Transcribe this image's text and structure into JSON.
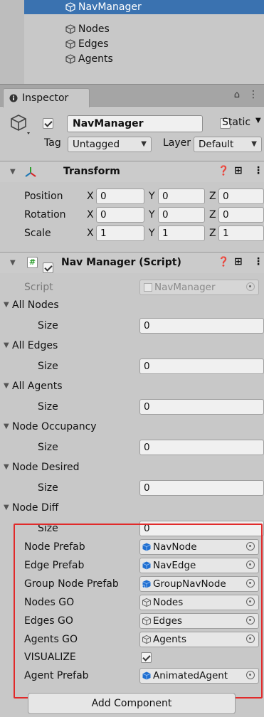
{
  "hierarchy": {
    "items": [
      {
        "label": "NavManager",
        "selected": true
      },
      {
        "label": "Nodes"
      },
      {
        "label": "Edges"
      },
      {
        "label": "Agents"
      }
    ]
  },
  "inspector": {
    "tab_label": "Inspector",
    "object_name": "NavManager",
    "static_label": "Static",
    "tag_label": "Tag",
    "tag_value": "Untagged",
    "layer_label": "Layer",
    "layer_value": "Default"
  },
  "transform": {
    "title": "Transform",
    "rows": [
      {
        "label": "Position",
        "x": "0",
        "y": "0",
        "z": "0"
      },
      {
        "label": "Rotation",
        "x": "0",
        "y": "0",
        "z": "0"
      },
      {
        "label": "Scale",
        "x": "1",
        "y": "1",
        "z": "1"
      }
    ],
    "axis_labels": {
      "x": "X",
      "y": "Y",
      "z": "Z"
    }
  },
  "script_component": {
    "title": "Nav Manager (Script)",
    "script_label": "Script",
    "script_value": "NavManager",
    "arrays": [
      {
        "label": "All Nodes",
        "size_label": "Size",
        "size": "0"
      },
      {
        "label": "All Edges",
        "size_label": "Size",
        "size": "0"
      },
      {
        "label": "All Agents",
        "size_label": "Size",
        "size": "0"
      },
      {
        "label": "Node Occupancy",
        "size_label": "Size",
        "size": "0"
      },
      {
        "label": "Node Desired",
        "size_label": "Size",
        "size": "0"
      },
      {
        "label": "Node Diff",
        "size_label": "Size",
        "size": "0"
      }
    ],
    "fields": [
      {
        "label": "Node Prefab",
        "value": "NavNode",
        "icon": "prefab-icon"
      },
      {
        "label": "Edge Prefab",
        "value": "NavEdge",
        "icon": "prefab-icon"
      },
      {
        "label": "Group Node Prefab",
        "value": "GroupNavNode",
        "icon": "prefab-variant-icon"
      },
      {
        "label": "Nodes GO",
        "value": "Nodes",
        "icon": "gameobject-icon"
      },
      {
        "label": "Edges GO",
        "value": "Edges",
        "icon": "gameobject-icon"
      },
      {
        "label": "Agents GO",
        "value": "Agents",
        "icon": "gameobject-icon"
      },
      {
        "label": "VISUALIZE",
        "checkbox": true
      },
      {
        "label": "Agent Prefab",
        "value": "AnimatedAgent",
        "icon": "prefab-icon"
      }
    ]
  },
  "add_component_label": "Add Component",
  "colors": {
    "selection": "#3a72b0",
    "highlight_box": "#e12a2a",
    "prefab": "#1f6fd1"
  }
}
